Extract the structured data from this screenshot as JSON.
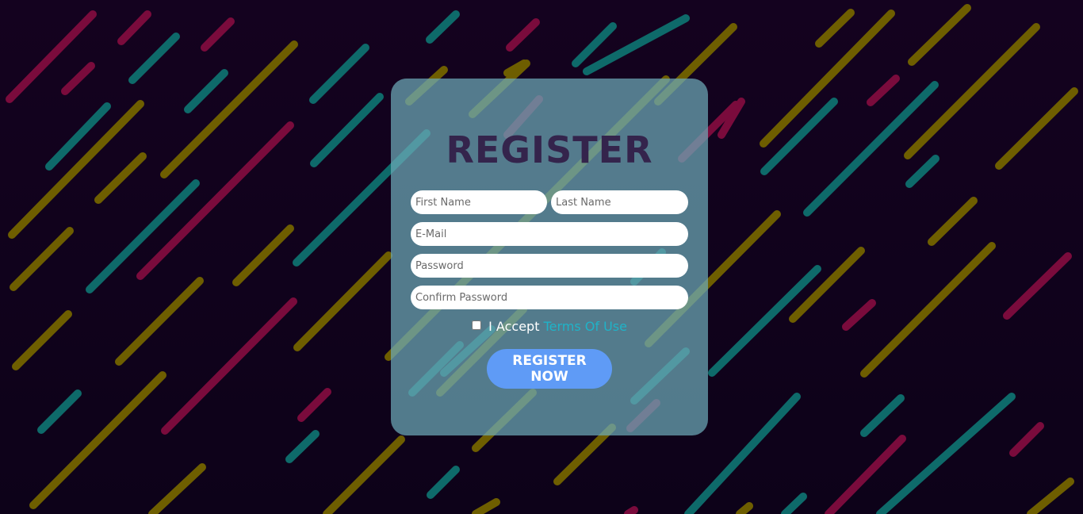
{
  "register_form": {
    "title": "REGISTER",
    "first_name_placeholder": "First Name",
    "last_name_placeholder": "Last Name",
    "email_placeholder": "E-Mail",
    "password_placeholder": "Password",
    "confirm_password_placeholder": "Confirm Password",
    "terms_prefix": "I Accept",
    "terms_link": "Terms Of Use",
    "submit_label": "REGISTER NOW"
  },
  "colors": {
    "background": "#0d0219",
    "card": "#6eaab9",
    "title": "#34244c",
    "button": "#5f9bf6",
    "link": "#1fb3c8",
    "stripe_crimson": "#7a0b3c",
    "stripe_teal": "#0e6a6a",
    "stripe_olive": "#6e5e00"
  }
}
